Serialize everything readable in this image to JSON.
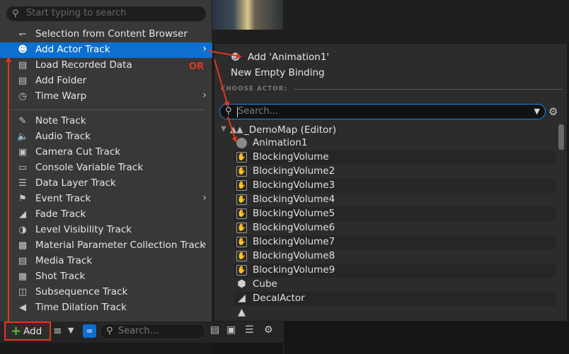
{
  "menu": {
    "search_placeholder": "Start typing to search",
    "items": [
      {
        "label": "Selection from Content Browser",
        "icon": "content-browser-icon",
        "submenu": false
      },
      {
        "label": "Add Actor Track",
        "icon": "actor-icon",
        "submenu": true,
        "highlighted": true
      },
      {
        "label": "Load Recorded Data",
        "icon": "folder-icon",
        "submenu": false
      },
      {
        "label": "Add Folder",
        "icon": "folder-icon",
        "submenu": false
      },
      {
        "label": "Time Warp",
        "icon": "clock-icon",
        "submenu": true
      }
    ],
    "tracks": [
      {
        "label": "Note Track",
        "icon": "note-icon",
        "submenu": false
      },
      {
        "label": "Audio Track",
        "icon": "speaker-icon",
        "submenu": false
      },
      {
        "label": "Camera Cut Track",
        "icon": "camera-icon",
        "submenu": false
      },
      {
        "label": "Console Variable Track",
        "icon": "console-icon",
        "submenu": false
      },
      {
        "label": "Data Layer Track",
        "icon": "layers-icon",
        "submenu": false
      },
      {
        "label": "Event Track",
        "icon": "flag-icon",
        "submenu": true
      },
      {
        "label": "Fade Track",
        "icon": "fade-icon",
        "submenu": false
      },
      {
        "label": "Level Visibility Track",
        "icon": "level-icon",
        "submenu": false
      },
      {
        "label": "Material Parameter Collection Track",
        "icon": "material-icon",
        "submenu": true
      },
      {
        "label": "Media Track",
        "icon": "tv-icon",
        "submenu": false
      },
      {
        "label": "Shot Track",
        "icon": "shot-icon",
        "submenu": false
      },
      {
        "label": "Subsequence Track",
        "icon": "subsequence-icon",
        "submenu": false
      },
      {
        "label": "Time Dilation Track",
        "icon": "time-dilation-icon",
        "submenu": false
      }
    ],
    "or_label": "OR"
  },
  "toolbar": {
    "add_label": "Add",
    "search_placeholder": "Search..."
  },
  "actor_submenu": {
    "add_animation": "Add 'Animation1'",
    "new_empty_binding": "New Empty Binding",
    "choose_actor_label": "CHOOSE ACTOR:",
    "search_placeholder": "Search...",
    "root": "_DemoMap (Editor)",
    "actors": [
      {
        "label": "Animation1",
        "icon": "animation-icon"
      },
      {
        "label": "BlockingVolume",
        "icon": "volume-icon"
      },
      {
        "label": "BlockingVolume2",
        "icon": "volume-icon"
      },
      {
        "label": "BlockingVolume3",
        "icon": "volume-icon"
      },
      {
        "label": "BlockingVolume4",
        "icon": "volume-icon"
      },
      {
        "label": "BlockingVolume5",
        "icon": "volume-icon"
      },
      {
        "label": "BlockingVolume6",
        "icon": "volume-icon"
      },
      {
        "label": "BlockingVolume7",
        "icon": "volume-icon"
      },
      {
        "label": "BlockingVolume8",
        "icon": "volume-icon"
      },
      {
        "label": "BlockingVolume9",
        "icon": "volume-icon"
      },
      {
        "label": "Cube",
        "icon": "cube-icon"
      },
      {
        "label": "DecalActor",
        "icon": "decal-icon"
      }
    ]
  },
  "colors": {
    "highlight": "#0d6fcf",
    "annotation": "#e0381c",
    "add_plus": "#5fbf3b"
  }
}
